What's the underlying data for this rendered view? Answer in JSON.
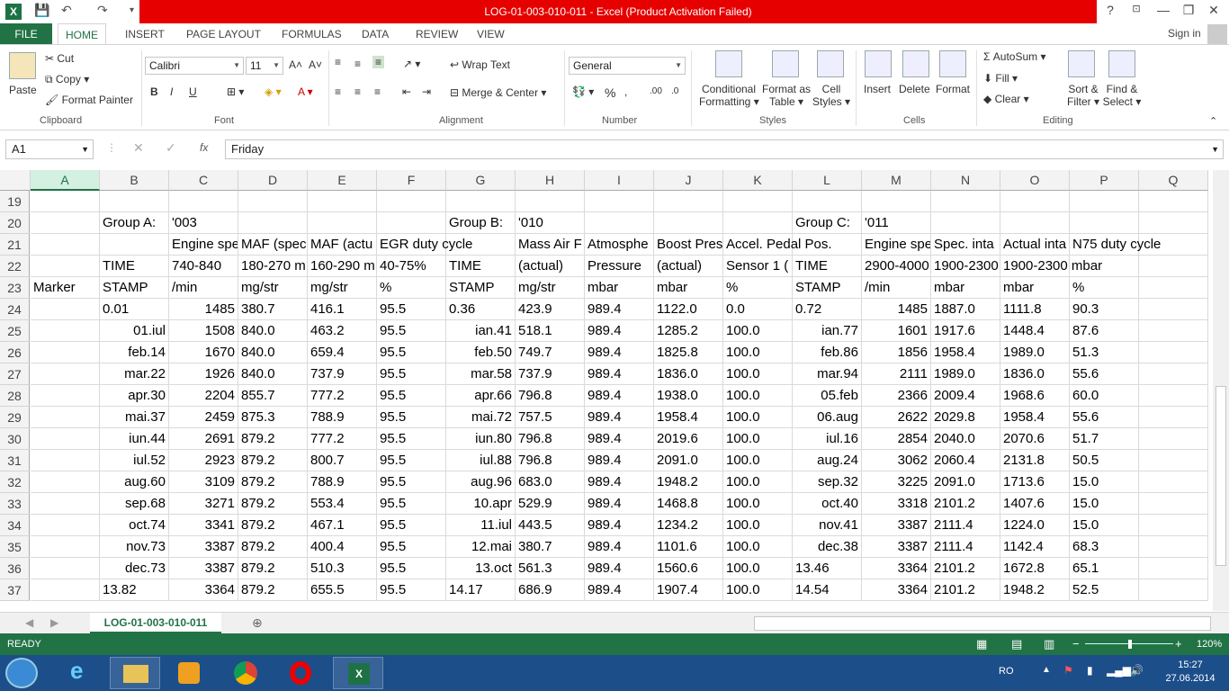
{
  "window": {
    "title": "LOG-01-003-010-011 -  Excel (Product Activation Failed)",
    "help": "?",
    "minimize": "—",
    "restore": "❐",
    "close": "✕"
  },
  "tabs": [
    "HOME",
    "INSERT",
    "PAGE LAYOUT",
    "FORMULAS",
    "DATA",
    "REVIEW",
    "VIEW"
  ],
  "file_tab": "FILE",
  "signin": "Sign in",
  "ribbon": {
    "clipboard": {
      "label": "Clipboard",
      "paste": "Paste",
      "cut": "Cut",
      "copy": "Copy",
      "format_painter": "Format Painter"
    },
    "font": {
      "label": "Font",
      "name": "Calibri",
      "size": "11"
    },
    "alignment": {
      "label": "Alignment",
      "wrap_text": "Wrap Text",
      "merge_center": "Merge & Center"
    },
    "number": {
      "label": "Number",
      "format": "General"
    },
    "styles": {
      "label": "Styles",
      "conditional": [
        "Conditional",
        "Formatting"
      ],
      "format_table": [
        "Format as",
        "Table"
      ],
      "cell_styles": [
        "Cell",
        "Styles"
      ]
    },
    "cells": {
      "label": "Cells",
      "insert": "Insert",
      "delete": "Delete",
      "format": "Format"
    },
    "editing": {
      "label": "Editing",
      "autosum": "AutoSum",
      "fill": "Fill",
      "clear": "Clear",
      "sort": [
        "Sort &",
        "Filter"
      ],
      "find": [
        "Find &",
        "Select"
      ]
    }
  },
  "formula_bar": {
    "name_box": "A1",
    "fx": "fx",
    "value": "Friday"
  },
  "columns": [
    "A",
    "B",
    "C",
    "D",
    "E",
    "F",
    "G",
    "H",
    "I",
    "J",
    "K",
    "L",
    "M",
    "N",
    "O",
    "P",
    "Q"
  ],
  "rows": [
    {
      "n": "19",
      "cells": [
        "",
        "",
        "",
        "",
        "",
        "",
        "",
        "",
        "",
        "",
        "",
        "",
        "",
        "",
        "",
        ""
      ]
    },
    {
      "n": "20",
      "cells": [
        "",
        "Group A:",
        "'003",
        "",
        "",
        "",
        "Group B:",
        "'010",
        "",
        "",
        "",
        "Group C:",
        "'011",
        "",
        "",
        ""
      ]
    },
    {
      "n": "21",
      "cells": [
        "",
        "",
        "Engine spe",
        "MAF (spec",
        "MAF (actu",
        "EGR duty cycle",
        "",
        "Mass Air F",
        "Atmosphe",
        "Boost Pres",
        "Accel. Pedal Pos.",
        "",
        "Engine spe",
        "Spec. inta",
        "Actual inta",
        "N75 duty cycle"
      ]
    },
    {
      "n": "22",
      "cells": [
        "",
        "TIME",
        "740-840",
        "180-270 m",
        "160-290 m",
        "40-75%",
        "TIME",
        "(actual)",
        "Pressure",
        "(actual)",
        "Sensor 1 (",
        "TIME",
        "2900-4000",
        "1900-2300",
        "1900-2300 mbar",
        ""
      ]
    },
    {
      "n": "23",
      "cells": [
        "Marker",
        "STAMP",
        "/min",
        "mg/str",
        "mg/str",
        "%",
        "STAMP",
        "mg/str",
        "mbar",
        "mbar",
        "%",
        "STAMP",
        "/min",
        "mbar",
        "mbar",
        "%"
      ]
    },
    {
      "n": "24",
      "cells": [
        "",
        "0.01",
        "1485",
        "380.7",
        "416.1",
        "95.5",
        "0.36",
        "423.9",
        "989.4",
        "1122.0",
        "0.0",
        "0.72",
        "1485",
        "1887.0",
        "1111.8",
        "90.3"
      ]
    },
    {
      "n": "25",
      "cells": [
        "",
        "01.iul",
        "1508",
        "840.0",
        "463.2",
        "95.5",
        "ian.41",
        "518.1",
        "989.4",
        "1285.2",
        "100.0",
        "ian.77",
        "1601",
        "1917.6",
        "1448.4",
        "87.6"
      ]
    },
    {
      "n": "26",
      "cells": [
        "",
        "feb.14",
        "1670",
        "840.0",
        "659.4",
        "95.5",
        "feb.50",
        "749.7",
        "989.4",
        "1825.8",
        "100.0",
        "feb.86",
        "1856",
        "1958.4",
        "1989.0",
        "51.3"
      ]
    },
    {
      "n": "27",
      "cells": [
        "",
        "mar.22",
        "1926",
        "840.0",
        "737.9",
        "95.5",
        "mar.58",
        "737.9",
        "989.4",
        "1836.0",
        "100.0",
        "mar.94",
        "2111",
        "1989.0",
        "1836.0",
        "55.6"
      ]
    },
    {
      "n": "28",
      "cells": [
        "",
        "apr.30",
        "2204",
        "855.7",
        "777.2",
        "95.5",
        "apr.66",
        "796.8",
        "989.4",
        "1938.0",
        "100.0",
        "05.feb",
        "2366",
        "2009.4",
        "1968.6",
        "60.0"
      ]
    },
    {
      "n": "29",
      "cells": [
        "",
        "mai.37",
        "2459",
        "875.3",
        "788.9",
        "95.5",
        "mai.72",
        "757.5",
        "989.4",
        "1958.4",
        "100.0",
        "06.aug",
        "2622",
        "2029.8",
        "1958.4",
        "55.6"
      ]
    },
    {
      "n": "30",
      "cells": [
        "",
        "iun.44",
        "2691",
        "879.2",
        "777.2",
        "95.5",
        "iun.80",
        "796.8",
        "989.4",
        "2019.6",
        "100.0",
        "iul.16",
        "2854",
        "2040.0",
        "2070.6",
        "51.7"
      ]
    },
    {
      "n": "31",
      "cells": [
        "",
        "iul.52",
        "2923",
        "879.2",
        "800.7",
        "95.5",
        "iul.88",
        "796.8",
        "989.4",
        "2091.0",
        "100.0",
        "aug.24",
        "3062",
        "2060.4",
        "2131.8",
        "50.5"
      ]
    },
    {
      "n": "32",
      "cells": [
        "",
        "aug.60",
        "3109",
        "879.2",
        "788.9",
        "95.5",
        "aug.96",
        "683.0",
        "989.4",
        "1948.2",
        "100.0",
        "sep.32",
        "3225",
        "2091.0",
        "1713.6",
        "15.0"
      ]
    },
    {
      "n": "33",
      "cells": [
        "",
        "sep.68",
        "3271",
        "879.2",
        "553.4",
        "95.5",
        "10.apr",
        "529.9",
        "989.4",
        "1468.8",
        "100.0",
        "oct.40",
        "3318",
        "2101.2",
        "1407.6",
        "15.0"
      ]
    },
    {
      "n": "34",
      "cells": [
        "",
        "oct.74",
        "3341",
        "879.2",
        "467.1",
        "95.5",
        "11.iul",
        "443.5",
        "989.4",
        "1234.2",
        "100.0",
        "nov.41",
        "3387",
        "2111.4",
        "1224.0",
        "15.0"
      ]
    },
    {
      "n": "35",
      "cells": [
        "",
        "nov.73",
        "3387",
        "879.2",
        "400.4",
        "95.5",
        "12.mai",
        "380.7",
        "989.4",
        "1101.6",
        "100.0",
        "dec.38",
        "3387",
        "2111.4",
        "1142.4",
        "68.3"
      ]
    },
    {
      "n": "36",
      "cells": [
        "",
        "dec.73",
        "3387",
        "879.2",
        "510.3",
        "95.5",
        "13.oct",
        "561.3",
        "989.4",
        "1560.6",
        "100.0",
        "13.46",
        "3364",
        "2101.2",
        "1672.8",
        "65.1"
      ]
    },
    {
      "n": "37",
      "cells": [
        "",
        "13.82",
        "3364",
        "879.2",
        "655.5",
        "95.5",
        "14.17",
        "686.9",
        "989.4",
        "1907.4",
        "100.0",
        "14.54",
        "3364",
        "2101.2",
        "1948.2",
        "52.5"
      ]
    }
  ],
  "sheet_tab": "LOG-01-003-010-011",
  "status": {
    "ready": "READY",
    "zoom": "120%"
  },
  "taskbar": {
    "lang": "RO",
    "time": "15:27",
    "date": "27.06.2014"
  }
}
